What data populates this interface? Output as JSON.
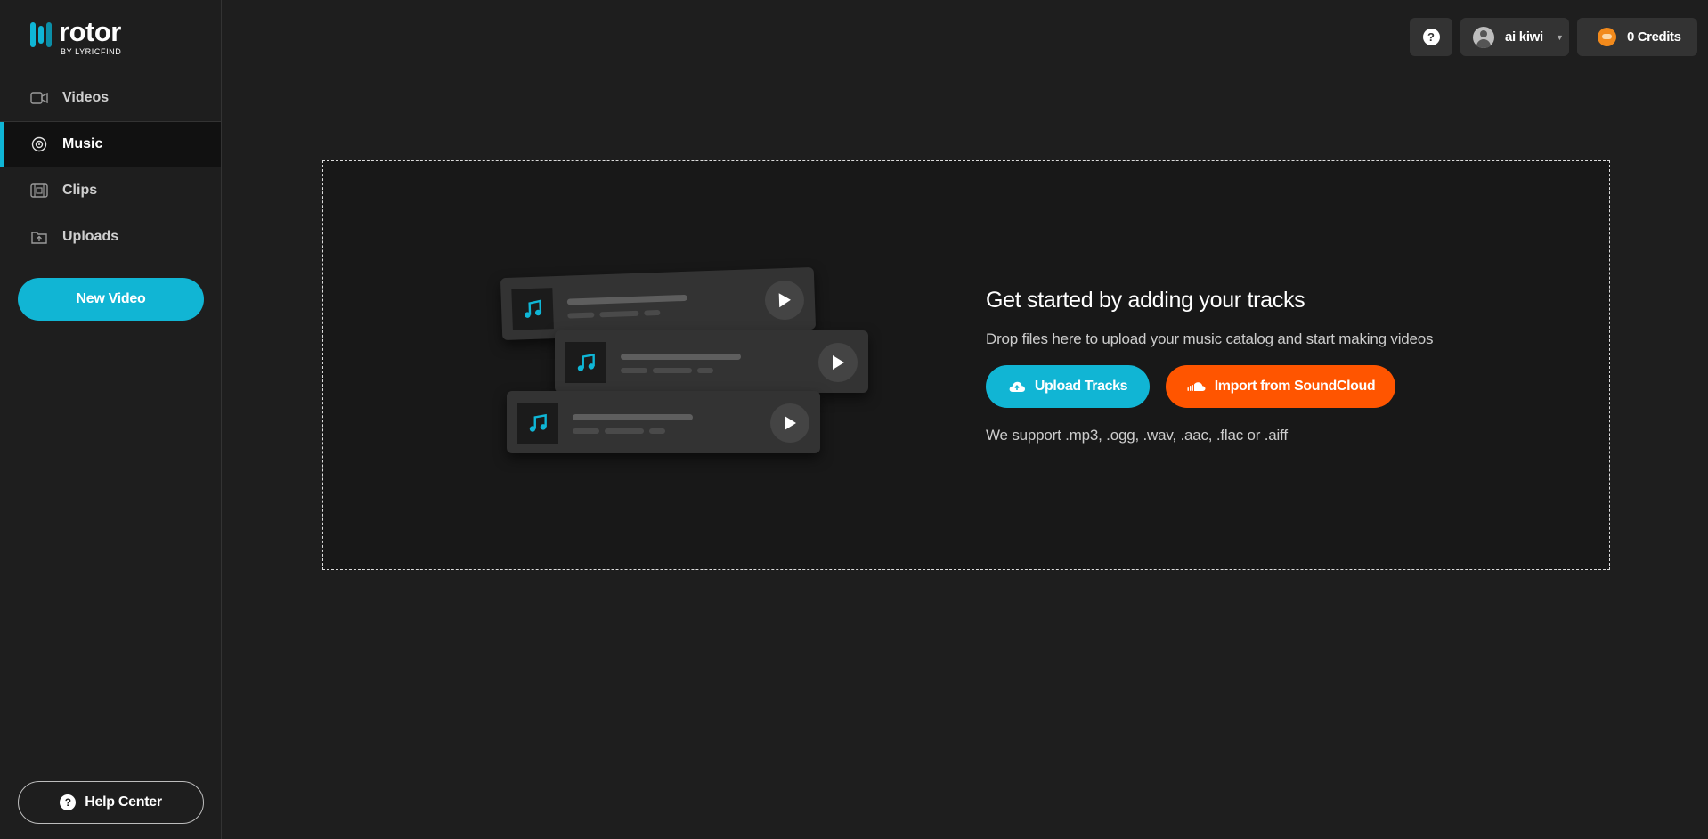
{
  "brand": {
    "name": "rotor",
    "tagline": "BY LYRICFIND",
    "accent": "#0fb6d6"
  },
  "sidebar": {
    "items": [
      {
        "label": "Videos",
        "icon": "video-camera-icon",
        "active": false
      },
      {
        "label": "Music",
        "icon": "vinyl-record-icon",
        "active": true
      },
      {
        "label": "Clips",
        "icon": "film-strip-icon",
        "active": false
      },
      {
        "label": "Uploads",
        "icon": "folder-upload-icon",
        "active": false
      }
    ],
    "new_video_label": "New Video",
    "help_center_label": "Help Center"
  },
  "topbar": {
    "help_icon": "question-icon",
    "user_name": "ai kiwi",
    "credits_label": "0 Credits"
  },
  "dropzone": {
    "title": "Get started by adding your tracks",
    "subtitle": "Drop files here to upload your music catalog and start making videos",
    "upload_label": "Upload Tracks",
    "soundcloud_label": "Import from SoundCloud",
    "formats": "We support .mp3, .ogg, .wav, .aac, .flac or .aiff",
    "soundcloud_color": "#ff5500"
  }
}
